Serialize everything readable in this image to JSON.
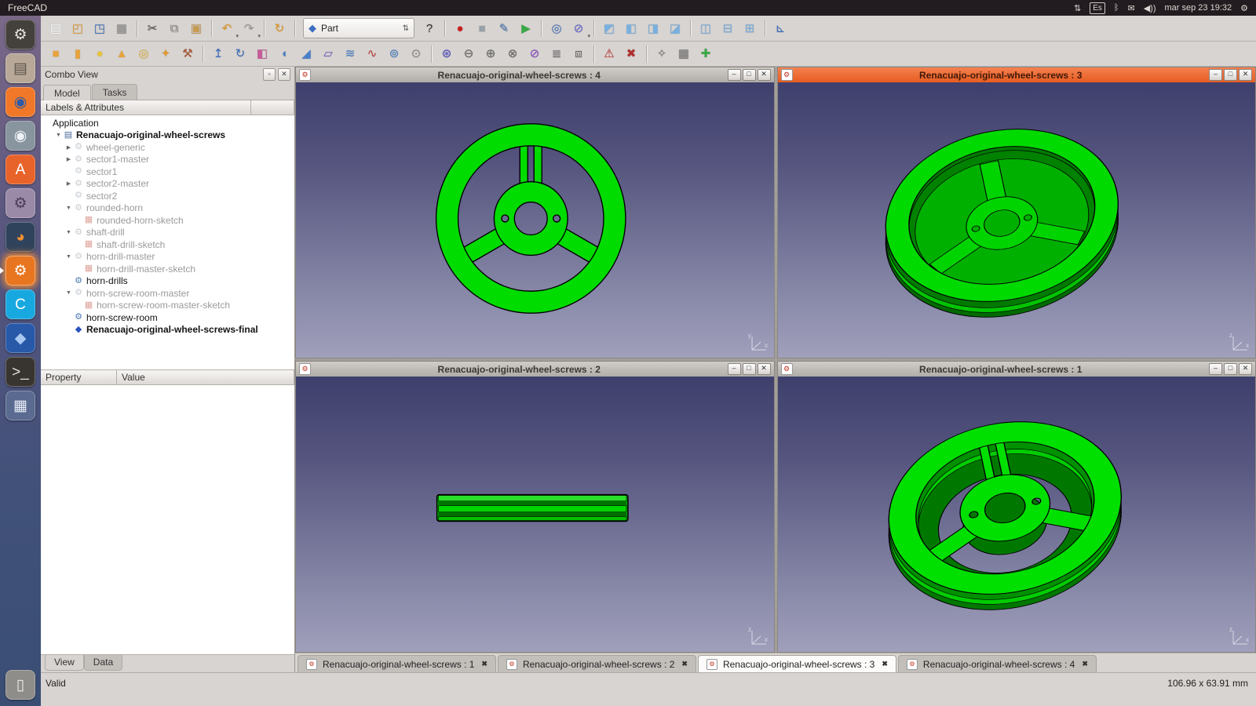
{
  "top_bar": {
    "app_title": "FreeCAD",
    "clock": "mar sep 23 19:32",
    "keyboard_layout": "Es",
    "tray": [
      {
        "name": "network-sync",
        "glyph": "⇅"
      },
      {
        "name": "keyboard-layout-indicator",
        "glyph": "Es",
        "boxed": true
      },
      {
        "name": "bluetooth",
        "glyph": "ᛒ"
      },
      {
        "name": "messages",
        "glyph": "✉"
      },
      {
        "name": "volume",
        "glyph": "◀))"
      },
      {
        "name": "clock",
        "bind": "clock"
      },
      {
        "name": "session-menu",
        "glyph": "⚙"
      }
    ]
  },
  "launcher": {
    "items": [
      {
        "name": "freecad-launcher",
        "glyph": "⚙",
        "bg": "#44403c",
        "fg": "#e8e4e0"
      },
      {
        "name": "file-manager",
        "glyph": "▤",
        "bg": "#b8a898",
        "fg": "#5a5248"
      },
      {
        "name": "firefox",
        "glyph": "◉",
        "bg": "#f07828",
        "fg": "#2a5aa8"
      },
      {
        "name": "chromium",
        "glyph": "◉",
        "bg": "#88949e",
        "fg": "#eef2f6"
      },
      {
        "name": "ubuntu-software",
        "glyph": "A",
        "bg": "#e8632a",
        "fg": "#ffffff"
      },
      {
        "name": "system-settings",
        "glyph": "⚙",
        "bg": "#9a8aa8",
        "fg": "#4a3a58"
      },
      {
        "name": "blender",
        "glyph": "◕",
        "bg": "#30435c",
        "fg": "#f09030"
      },
      {
        "name": "freecad-part-workbench",
        "glyph": "⚙",
        "bg": "#e8751f",
        "fg": "#ffffff",
        "active": true,
        "running": true
      },
      {
        "name": "cura",
        "glyph": "C",
        "bg": "#18a8e0",
        "fg": "#ffffff"
      },
      {
        "name": "cad-utility",
        "glyph": "◆",
        "bg": "#2858a8",
        "fg": "#a8c8f0"
      },
      {
        "name": "terminal",
        "glyph": ">_",
        "bg": "#383430",
        "fg": "#e0e0e0"
      },
      {
        "name": "workspace-switcher",
        "glyph": "▦",
        "bg": "#5a6a90",
        "fg": "#e8eef8"
      }
    ],
    "trash": {
      "name": "trash",
      "glyph": "▯",
      "bg": "#8f8d8a",
      "fg": "#ededeb"
    }
  },
  "workbench_selector": {
    "value": "Part"
  },
  "toolbar_main": {
    "items": [
      {
        "name": "new-document",
        "glyph": "▤",
        "color": "#ffffff"
      },
      {
        "name": "open-document",
        "glyph": "◰",
        "color": "#e0a23c"
      },
      {
        "name": "save-document",
        "glyph": "◳",
        "color": "#3e6fc0"
      },
      {
        "name": "print",
        "glyph": "▦",
        "color": "#909090"
      },
      {
        "sep": true
      },
      {
        "name": "cut",
        "glyph": "✂",
        "color": "#505050"
      },
      {
        "name": "copy",
        "glyph": "⧉",
        "color": "#8a8a8a"
      },
      {
        "name": "paste",
        "glyph": "▣",
        "color": "#c89a50"
      },
      {
        "sep": true
      },
      {
        "name": "undo",
        "glyph": "↶",
        "color": "#e09a2a",
        "dropdown": true
      },
      {
        "name": "redo",
        "glyph": "↷",
        "color": "#9a9a9a",
        "dropdown": true
      },
      {
        "sep": true
      },
      {
        "name": "refresh",
        "glyph": "↻",
        "color": "#e09a2a"
      },
      {
        "sep": true
      },
      {
        "combo": true,
        "name": "workbench-selector",
        "glyph": "◆",
        "color": "#3e6fc0"
      },
      {
        "name": "whats-this",
        "glyph": "?",
        "color": "#303030"
      },
      {
        "sep": true
      },
      {
        "name": "macro-record",
        "glyph": "●",
        "color": "#cc2020"
      },
      {
        "name": "macro-stop",
        "glyph": "■",
        "color": "#9aa0a8"
      },
      {
        "name": "macro-edit",
        "glyph": "✎",
        "color": "#4a7ab5"
      },
      {
        "name": "macro-play",
        "glyph": "▶",
        "color": "#38a845"
      },
      {
        "sep": true
      },
      {
        "name": "fit-all",
        "glyph": "◎",
        "color": "#3e6fc0"
      },
      {
        "name": "draw-style",
        "glyph": "⊘",
        "color": "#6868d0",
        "dropdown": true
      },
      {
        "sep": true
      },
      {
        "name": "view-axonometric",
        "glyph": "◩",
        "color": "#78b0e0"
      },
      {
        "name": "view-front",
        "glyph": "◧",
        "color": "#78b0e0"
      },
      {
        "name": "view-top",
        "glyph": "◨",
        "color": "#78b0e0"
      },
      {
        "name": "view-right",
        "glyph": "◪",
        "color": "#78b0e0"
      },
      {
        "sep": true
      },
      {
        "name": "view-rear",
        "glyph": "◫",
        "color": "#78b0e0"
      },
      {
        "name": "view-bottom",
        "glyph": "⊟",
        "color": "#78b0e0"
      },
      {
        "name": "view-left",
        "glyph": "⊞",
        "color": "#78b0e0"
      },
      {
        "sep": true
      },
      {
        "name": "measure-linear",
        "glyph": "⊾",
        "color": "#3e6fc0"
      }
    ]
  },
  "toolbar_part": {
    "items": [
      {
        "name": "part-box",
        "glyph": "■",
        "color": "#e8a33d"
      },
      {
        "name": "part-cylinder",
        "glyph": "▮",
        "color": "#e8a33d"
      },
      {
        "name": "part-sphere",
        "glyph": "●",
        "color": "#e8c23d"
      },
      {
        "name": "part-cone",
        "glyph": "▲",
        "color": "#e8a33d"
      },
      {
        "name": "part-torus",
        "glyph": "◎",
        "color": "#e8b83d"
      },
      {
        "name": "create-primitives",
        "glyph": "✦",
        "color": "#e09a30"
      },
      {
        "name": "shape-builder",
        "glyph": "⚒",
        "color": "#a85838"
      },
      {
        "sep": true
      },
      {
        "name": "extrude",
        "glyph": "↥",
        "color": "#3e6fc0"
      },
      {
        "name": "revolve",
        "glyph": "↻",
        "color": "#3e6fc0"
      },
      {
        "name": "mirror",
        "glyph": "◧",
        "color": "#c85a9a"
      },
      {
        "name": "fillet",
        "glyph": "◖",
        "color": "#4a80c8"
      },
      {
        "name": "chamfer",
        "glyph": "◢",
        "color": "#4a80c8"
      },
      {
        "name": "ruled-surface",
        "glyph": "▱",
        "color": "#7a5ac8"
      },
      {
        "name": "loft",
        "glyph": "≋",
        "color": "#4a80c8"
      },
      {
        "name": "sweep",
        "glyph": "∿",
        "color": "#c04040"
      },
      {
        "name": "offset",
        "glyph": "⊚",
        "color": "#4a80c8"
      },
      {
        "name": "thickness",
        "glyph": "⊙",
        "color": "#8a8a8a"
      },
      {
        "sep": true
      },
      {
        "name": "boolean",
        "glyph": "⊛",
        "color": "#5050c8"
      },
      {
        "name": "boolean-cut",
        "glyph": "⊖",
        "color": "#686868"
      },
      {
        "name": "boolean-union",
        "glyph": "⊕",
        "color": "#686868"
      },
      {
        "name": "boolean-intersection",
        "glyph": "⊗",
        "color": "#686868"
      },
      {
        "name": "section",
        "glyph": "⊘",
        "color": "#8a4ac8"
      },
      {
        "name": "cross-sections",
        "glyph": "≣",
        "color": "#585858"
      },
      {
        "name": "compound",
        "glyph": "⧈",
        "color": "#686868"
      },
      {
        "sep": true
      },
      {
        "name": "check-geometry",
        "glyph": "⚠",
        "color": "#cc3838"
      },
      {
        "name": "defeaturing",
        "glyph": "✖",
        "color": "#b03030"
      },
      {
        "sep": true
      },
      {
        "name": "refine-shape",
        "glyph": "✧",
        "color": "#787878"
      },
      {
        "name": "shape-from-mesh",
        "glyph": "▦",
        "color": "#787878"
      },
      {
        "name": "add-item",
        "glyph": "✚",
        "color": "#3aa845"
      }
    ]
  },
  "combo_view": {
    "title": "Combo View",
    "tabs": [
      {
        "label": "Model",
        "active": true
      },
      {
        "label": "Tasks",
        "active": false
      }
    ],
    "tree_header": "Labels & Attributes",
    "tree": [
      {
        "label": "Application",
        "depth": 0,
        "arrow": "",
        "icon": "",
        "bold": false,
        "dim": false
      },
      {
        "label": "Renacuajo-original-wheel-screws",
        "depth": 1,
        "arrow": "down",
        "icon": "doc",
        "bold": true,
        "dim": false
      },
      {
        "label": "wheel-generic",
        "depth": 2,
        "arrow": "right",
        "icon": "part",
        "bold": false,
        "dim": true
      },
      {
        "label": "sector1-master",
        "depth": 2,
        "arrow": "right",
        "icon": "part",
        "bold": false,
        "dim": true
      },
      {
        "label": "sector1",
        "depth": 2,
        "arrow": "",
        "icon": "part",
        "bold": false,
        "dim": true
      },
      {
        "label": "sector2-master",
        "depth": 2,
        "arrow": "right",
        "icon": "part",
        "bold": false,
        "dim": true
      },
      {
        "label": "sector2",
        "depth": 2,
        "arrow": "",
        "icon": "part",
        "bold": false,
        "dim": true
      },
      {
        "label": "rounded-horn",
        "depth": 2,
        "arrow": "down",
        "icon": "part",
        "bold": false,
        "dim": true
      },
      {
        "label": "rounded-horn-sketch",
        "depth": 3,
        "arrow": "",
        "icon": "sketch",
        "bold": false,
        "dim": true
      },
      {
        "label": "shaft-drill",
        "depth": 2,
        "arrow": "down",
        "icon": "part",
        "bold": false,
        "dim": true
      },
      {
        "label": "shaft-drill-sketch",
        "depth": 3,
        "arrow": "",
        "icon": "sketch",
        "bold": false,
        "dim": true
      },
      {
        "label": "horn-drill-master",
        "depth": 2,
        "arrow": "down",
        "icon": "part",
        "bold": false,
        "dim": true
      },
      {
        "label": "horn-drill-master-sketch",
        "depth": 3,
        "arrow": "",
        "icon": "sketch",
        "bold": false,
        "dim": true
      },
      {
        "label": "horn-drills",
        "depth": 2,
        "arrow": "",
        "icon": "solid",
        "bold": false,
        "dim": false
      },
      {
        "label": "horn-screw-room-master",
        "depth": 2,
        "arrow": "down",
        "icon": "part",
        "bold": false,
        "dim": true
      },
      {
        "label": "horn-screw-room-master-sketch",
        "depth": 3,
        "arrow": "",
        "icon": "sketch",
        "bold": false,
        "dim": true
      },
      {
        "label": "horn-screw-room",
        "depth": 2,
        "arrow": "",
        "icon": "solid",
        "bold": false,
        "dim": false
      },
      {
        "label": "Renacuajo-original-wheel-screws-final",
        "depth": 2,
        "arrow": "",
        "icon": "final",
        "bold": true,
        "dim": false
      }
    ],
    "property_table": {
      "columns": [
        "Property",
        "Value"
      ],
      "rows": []
    },
    "bottom_tabs": [
      {
        "label": "View",
        "active": true
      },
      {
        "label": "Data",
        "active": false
      }
    ]
  },
  "mdi": {
    "windows": [
      {
        "title": "Renacuajo-original-wheel-screws : 4",
        "active": false,
        "view": "front",
        "axis_up": "y",
        "axis_right": "x"
      },
      {
        "title": "Renacuajo-original-wheel-screws : 3",
        "active": true,
        "view": "iso_back",
        "axis_up": "z",
        "axis_right": "x"
      },
      {
        "title": "Renacuajo-original-wheel-screws : 2",
        "active": false,
        "view": "side",
        "axis_up": "z",
        "axis_right": "x"
      },
      {
        "title": "Renacuajo-original-wheel-screws : 1",
        "active": false,
        "view": "iso_front",
        "axis_up": "z",
        "axis_right": "x"
      }
    ],
    "window_controls": [
      {
        "name": "minimize",
        "glyph": "–"
      },
      {
        "name": "maximize",
        "glyph": "□"
      },
      {
        "name": "close",
        "glyph": "✕"
      }
    ],
    "doc_tabs": [
      {
        "label": "Renacuajo-original-wheel-screws : 1"
      },
      {
        "label": "Renacuajo-original-wheel-screws : 2"
      },
      {
        "label": "Renacuajo-original-wheel-screws : 3"
      },
      {
        "label": "Renacuajo-original-wheel-screws : 4"
      }
    ],
    "active_tab_index": 2
  },
  "status_bar": {
    "left": "Valid",
    "right": "106.96 x 63.91 mm"
  },
  "icons": {
    "expander_down": "▼",
    "expander_right": "▶",
    "doc_tab_close": "✖",
    "window_doc": "⚙",
    "panel_float": "▫",
    "panel_close": "✕",
    "dropdown": "▾",
    "spinner": "⇅"
  },
  "colors": {
    "accent_orange": "#e95420",
    "model_green": "#00dc00",
    "viewport_top": "#3f3f6d",
    "viewport_bottom": "#a0a0bc"
  }
}
